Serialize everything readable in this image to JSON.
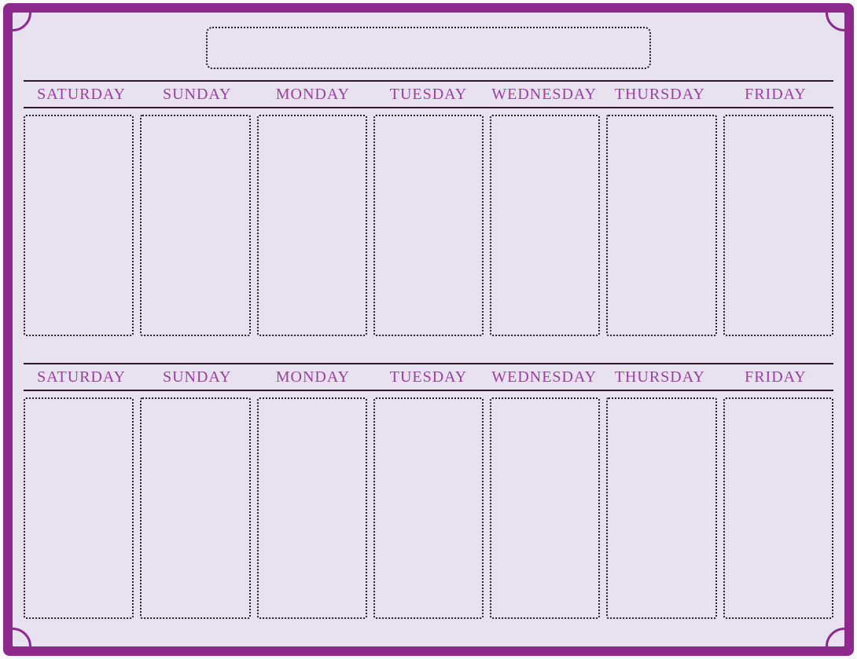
{
  "title": "",
  "colors": {
    "frame": "#8e2a8e",
    "panel": "#e8e2f0",
    "headerText": "#9a3fa0",
    "rule": "#2a1a2a"
  },
  "weeks": [
    {
      "days": [
        {
          "label": "SATURDAY"
        },
        {
          "label": "SUNDAY"
        },
        {
          "label": "MONDAY"
        },
        {
          "label": "TUESDAY"
        },
        {
          "label": "WEDNESDAY"
        },
        {
          "label": "THURSDAY"
        },
        {
          "label": "FRIDAY"
        }
      ]
    },
    {
      "days": [
        {
          "label": "SATURDAY"
        },
        {
          "label": "SUNDAY"
        },
        {
          "label": "MONDAY"
        },
        {
          "label": "TUESDAY"
        },
        {
          "label": "WEDNESDAY"
        },
        {
          "label": "THURSDAY"
        },
        {
          "label": "FRIDAY"
        }
      ]
    }
  ]
}
